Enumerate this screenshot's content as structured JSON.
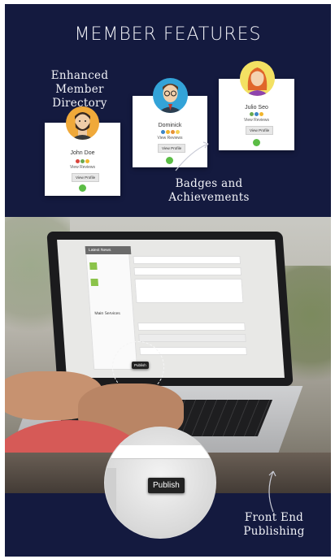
{
  "title": "MEMBER FEATURES",
  "labels": {
    "directory": "Enhanced Member Directory",
    "directory_l1": "Enhanced Member",
    "directory_l2": "Directory",
    "badges_l1": "Badges and",
    "badges_l2": "Achievements",
    "publishing_l1": "Front End",
    "publishing_l2": "Publishing"
  },
  "cards": [
    {
      "name": "John Doe",
      "view_reviews": "View Reviews",
      "view_profile": "View Profile"
    },
    {
      "name": "Dominick",
      "view_reviews": "View Reviews",
      "view_profile": "View Profile"
    },
    {
      "name": "Julio Seo",
      "view_reviews": "View Reviews",
      "view_profile": "View Profile"
    }
  ],
  "screen": {
    "latest_news": "Latest News",
    "main_services": "Main Services",
    "publish_small": "Publish",
    "publish_zoom": "Publish"
  },
  "colors": {
    "background": "#141a3f",
    "accent_green": "#5bbd45"
  }
}
